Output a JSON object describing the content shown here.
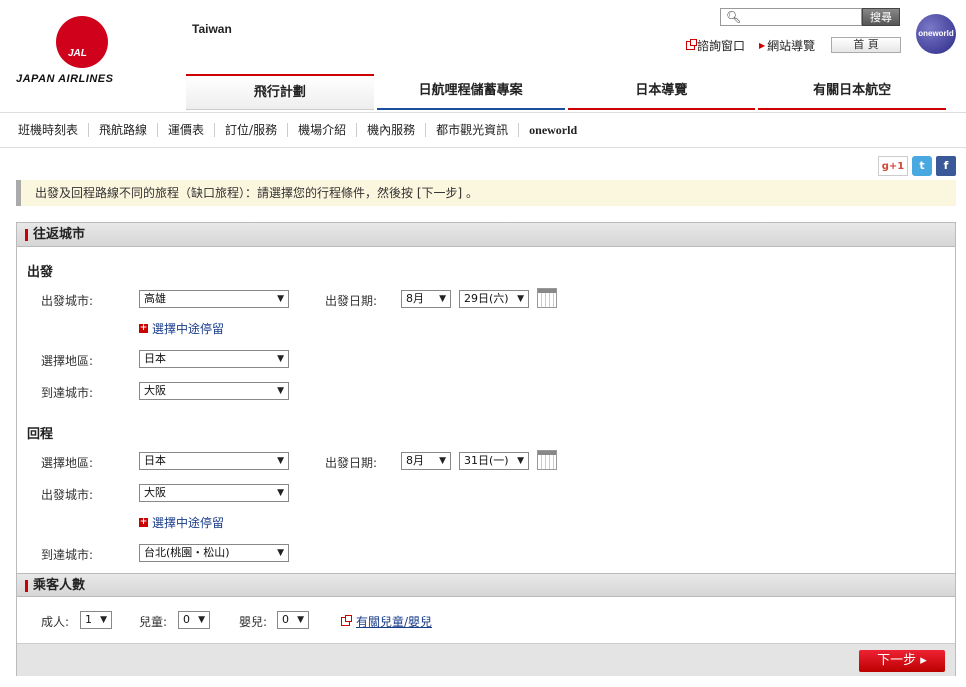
{
  "brand": {
    "logo_mark": "JAL",
    "name": "JAPAN AIRLINES",
    "region": "Taiwan"
  },
  "search": {
    "placeholder": "",
    "button": "搜尋"
  },
  "oneworld_badge": "oneworld",
  "util": {
    "contact": "諮詢窗口",
    "sitemap": "網站導覽",
    "home": "首 頁"
  },
  "main_nav": [
    "飛行計劃",
    "日航哩程儲蓄專案",
    "日本導覽",
    "有關日本航空"
  ],
  "sub_nav": [
    "班機時刻表",
    "飛航路線",
    "運價表",
    "訂位/服務",
    "機場介紹",
    "機內服務",
    "都市觀光資訊",
    "oneworld"
  ],
  "social": {
    "gplus": "g+1",
    "twitter": "t",
    "facebook": "f"
  },
  "notice": "出發及回程路線不同的旅程（缺口旅程）：請選擇您的行程條件，然後按 [下一步] 。",
  "route_section": {
    "title": "往返城市",
    "outbound": {
      "title": "出發",
      "dep_city_label": "出發城市:",
      "dep_city": "高雄",
      "dep_date_label": "出發日期:",
      "month": "8月",
      "day": "29日(六)",
      "stopover": "選擇中途停留",
      "region_label": "選擇地區:",
      "region": "日本",
      "arr_city_label": "到達城市:",
      "arr_city": "大阪"
    },
    "return": {
      "title": "回程",
      "region_label": "選擇地區:",
      "region": "日本",
      "dep_date_label": "出發日期:",
      "month": "8月",
      "day": "31日(一)",
      "dep_city_label": "出發城市:",
      "dep_city": "大阪",
      "stopover": "選擇中途停留",
      "arr_city_label": "到達城市:",
      "arr_city": "台北(桃園・松山)"
    }
  },
  "passenger_section": {
    "title": "乘客人數",
    "adult_label": "成人:",
    "adult": "1",
    "child_label": "兒童:",
    "child": "0",
    "infant_label": "嬰兒:",
    "infant": "0",
    "info_link": "有關兒童/嬰兒"
  },
  "next_button": "下一步 ▸",
  "colors": {
    "brand_red": "#cc0000",
    "link_blue": "#1a3d8a"
  }
}
